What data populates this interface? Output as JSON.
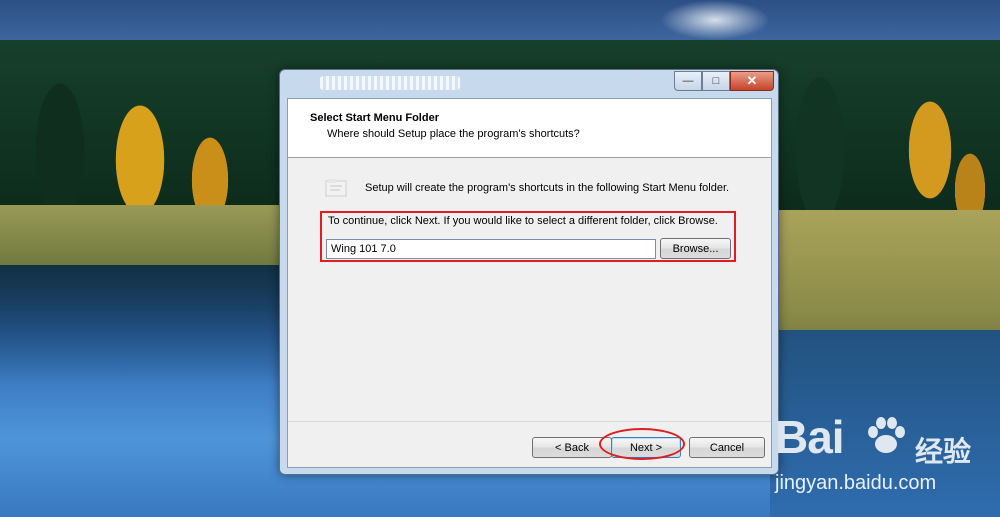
{
  "window": {
    "controls": {
      "minimize": "—",
      "maximize": "□",
      "close": "✕"
    }
  },
  "header": {
    "title": "Select Start Menu Folder",
    "subtitle": "Where should Setup place the program's shortcuts?"
  },
  "body": {
    "info_text": "Setup will create the program's shortcuts in the following Start Menu folder.",
    "instruction_text": "To continue, click Next. If you would like to select a different folder, click Browse.",
    "folder_value": "Wing 101 7.0",
    "browse_label": "Browse..."
  },
  "footer": {
    "back_label": "< Back",
    "next_label": "Next >",
    "cancel_label": "Cancel"
  },
  "watermark": {
    "logo": "Bai",
    "cn": "经验",
    "url": "jingyan.baidu.com"
  },
  "icons": [
    "folder-icon",
    "minimize-icon",
    "maximize-icon",
    "close-icon",
    "paw-icon"
  ],
  "colors": {
    "annotation": "#e01e1e",
    "default_button": "#3c7fb1"
  }
}
